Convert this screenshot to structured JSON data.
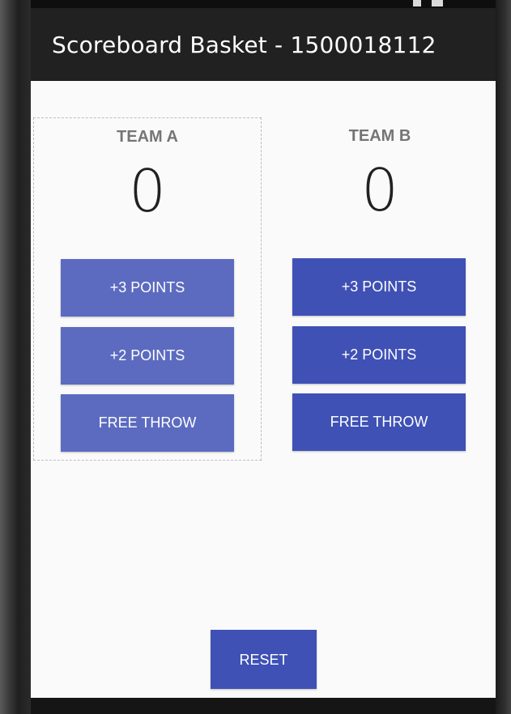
{
  "app_bar": {
    "title": "Scoreboard Basket - 1500018112"
  },
  "team_a": {
    "name": "TEAM A",
    "score": "0",
    "btn_three": "+3 POINTS",
    "btn_two": "+2 POINTS",
    "btn_free_throw": "FREE THROW"
  },
  "team_b": {
    "name": "TEAM B",
    "score": "0",
    "btn_three": "+3 POINTS",
    "btn_two": "+2 POINTS",
    "btn_free_throw": "FREE THROW"
  },
  "reset_label": "RESET",
  "colors": {
    "app_bar": "#212121",
    "content_bg": "#fafafa",
    "team_a_button": "#5c6bc0",
    "team_b_button": "#3f51b5",
    "team_label": "#757575"
  }
}
